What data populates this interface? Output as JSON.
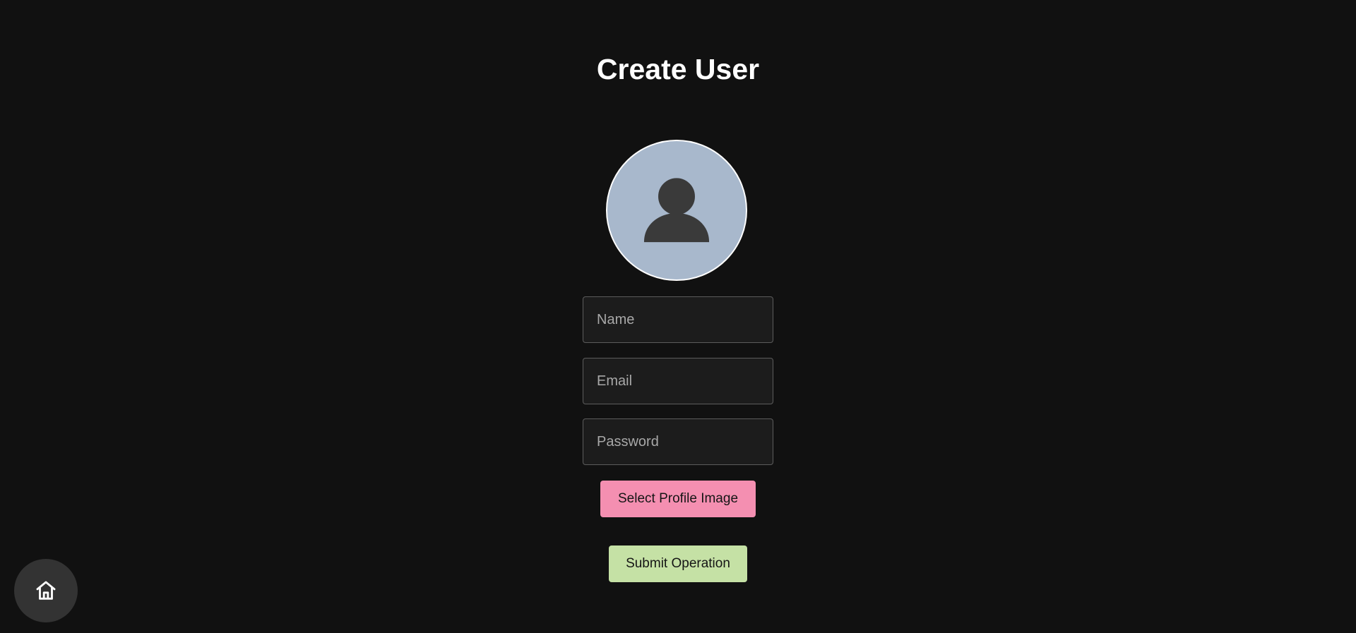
{
  "page": {
    "title": "Create User"
  },
  "avatar": {
    "icon": "person-icon",
    "background": "#a8b8cc"
  },
  "form": {
    "name_placeholder": "Name",
    "name_value": "",
    "email_placeholder": "Email",
    "email_value": "",
    "password_placeholder": "Password",
    "password_value": "",
    "select_image_label": "Select Profile Image",
    "submit_label": "Submit Operation"
  },
  "nav": {
    "home_icon": "home-icon"
  },
  "colors": {
    "background": "#111111",
    "select_button": "#f48fb1",
    "submit_button": "#c5e1a5",
    "fab": "#333333"
  }
}
